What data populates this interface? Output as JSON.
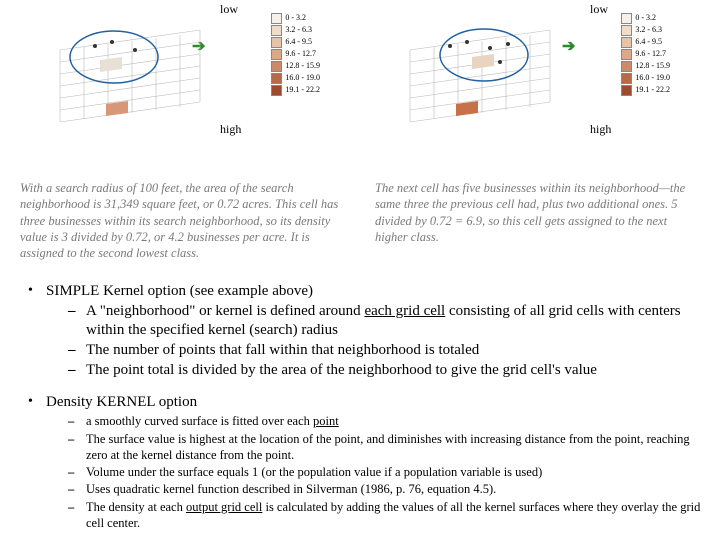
{
  "labels": {
    "low": "low",
    "high": "high"
  },
  "legend": [
    {
      "color": "#f7f0e8",
      "text": "0 - 3.2"
    },
    {
      "color": "#f0dcc8",
      "text": "3.2 - 6.3"
    },
    {
      "color": "#e8c4a6",
      "text": "6.4 - 9.5"
    },
    {
      "color": "#dca886",
      "text": "9.6 - 12.7"
    },
    {
      "color": "#cc8a66",
      "text": "12.8 - 15.9"
    },
    {
      "color": "#b86a48",
      "text": "16.0 - 19.0"
    },
    {
      "color": "#a04a2c",
      "text": "19.1 - 22.2"
    }
  ],
  "captionLeft": "With a search radius of 100 feet, the area of the search neighborhood is 31,349 square feet, or 0.72 acres. This cell has three businesses within its search neighborhood, so its density value is 3 divided by 0.72, or 4.2 businesses per acre. It is assigned to the second lowest class.",
  "captionRight": "The next cell has five businesses within its neighborhood—the same three the previous cell had, plus two additional ones. 5 divided by 0.72 = 6.9, so this cell gets assigned to the next higher class.",
  "simple": {
    "title": "SIMPLE Kernel  option (see example above)",
    "items": [
      {
        "pre": "A \"neighborhood\" or kernel is defined around ",
        "under": "each grid cell",
        "post": " consisting of  all grid cells with centers within the specified kernel (search) radius"
      },
      {
        "pre": "The number of points that fall within that neighborhood is totaled",
        "under": "",
        "post": ""
      },
      {
        "pre": "The point total is divided by the area of the neighborhood to give the grid cell's value",
        "under": "",
        "post": ""
      }
    ]
  },
  "density": {
    "title": "Density KERNEL option",
    "items": [
      {
        "pre": "a smoothly curved surface is fitted over each ",
        "under": "point",
        "post": ""
      },
      {
        "pre": "The surface value is highest at the location of the point, and diminishes with increasing distance from the point, reaching zero at the kernel distance from the point.",
        "under": "",
        "post": ""
      },
      {
        "pre": "Volume under the surface equals 1 (or the population value if a population variable is used)",
        "under": "",
        "post": ""
      },
      {
        "pre": "Uses quadratic kernel function described in Silverman (1986, p. 76, equation 4.5).",
        "under": "",
        "post": ""
      },
      {
        "pre": "The density at each ",
        "under": "output grid cell",
        "post": " is calculated by adding the values of all the kernel surfaces where they overlay the grid cell center."
      }
    ]
  }
}
